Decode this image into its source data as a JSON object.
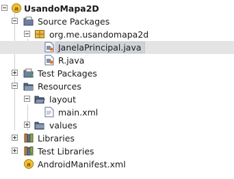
{
  "tree": {
    "project": "UsandoMapa2D",
    "source_packages": "Source Packages",
    "package": "org.me.usandomapa2d",
    "file_main": "JanelaPrincipal.java",
    "file_r": "R.java",
    "test_packages": "Test Packages",
    "resources": "Resources",
    "layout": "layout",
    "main_xml": "main.xml",
    "values": "values",
    "libraries": "Libraries",
    "test_libraries": "Test Libraries",
    "manifest": "AndroidManifest.xml"
  }
}
